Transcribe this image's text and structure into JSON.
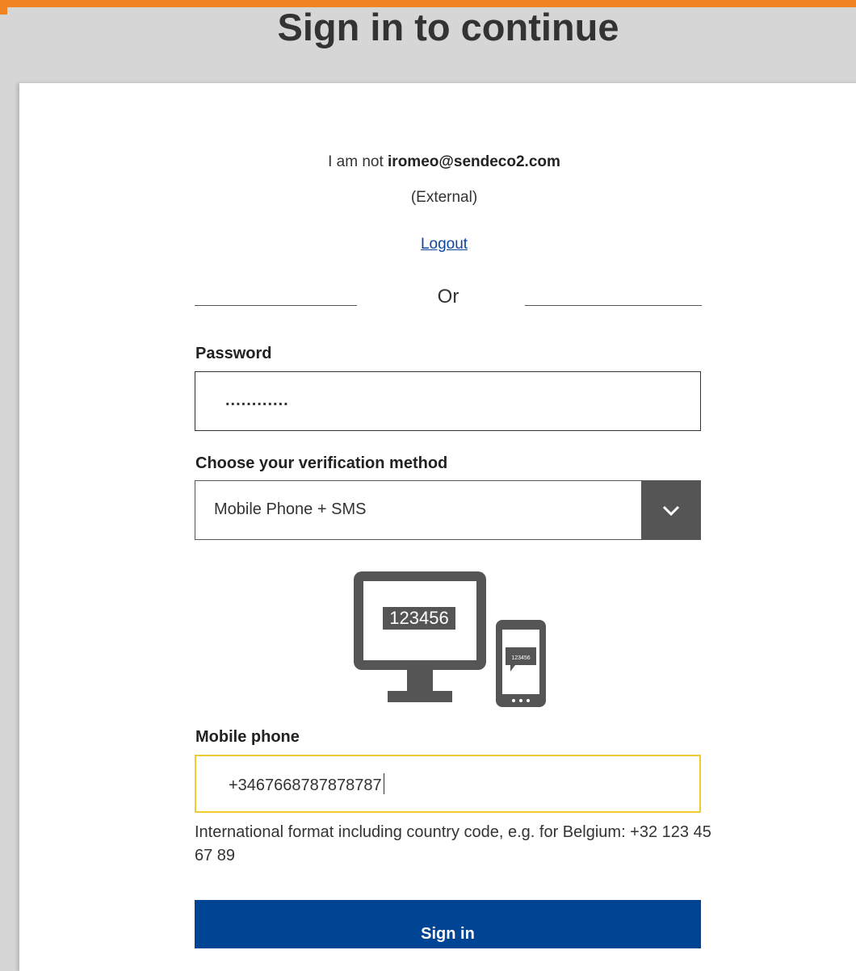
{
  "header": {
    "title": "Sign in to continue"
  },
  "account": {
    "prefix": "I am not ",
    "email": "iromeo@sendeco2.com",
    "type": "(External)",
    "logout_label": "Logout",
    "or_label": "Or"
  },
  "password": {
    "label": "Password",
    "masked_value": "............"
  },
  "verification": {
    "label": "Choose your verification method",
    "selected": "Mobile Phone + SMS"
  },
  "illustration": {
    "code_desktop": "123456",
    "code_phone": "123456"
  },
  "mobile": {
    "label": "Mobile phone",
    "value": "+3467668787878787",
    "help": "International format including country code, e.g. for Belgium: +32 123 45 67 89"
  },
  "actions": {
    "signin_label": "Sign in"
  },
  "colors": {
    "accent": "#f28322",
    "primary": "#004494",
    "focus": "#f0cb2e"
  }
}
